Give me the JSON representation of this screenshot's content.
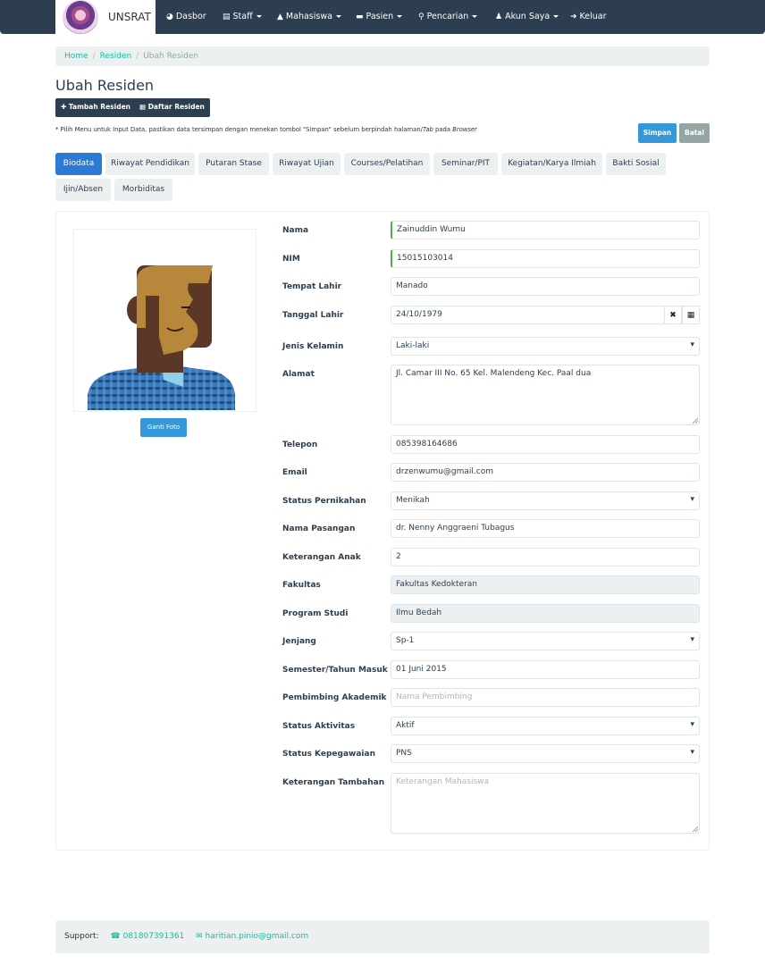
{
  "navbar": {
    "brand": "UNSRAT",
    "items": [
      {
        "label": "Dasbor",
        "icon": "dashboard-icon"
      },
      {
        "label": "Staff",
        "icon": "list-icon",
        "dropdown": true
      },
      {
        "label": "Mahasiswa",
        "icon": "graduation-cap-icon",
        "dropdown": true
      },
      {
        "label": "Pasien",
        "icon": "bed-icon",
        "dropdown": true
      },
      {
        "label": "Pencarian",
        "icon": "search-icon",
        "dropdown": true
      },
      {
        "label": "Akun Saya",
        "icon": "user-icon",
        "dropdown": true
      },
      {
        "label": "Keluar",
        "icon": "sign-out-icon"
      }
    ]
  },
  "breadcrumb": [
    "Home",
    "Residen",
    "Ubah Residen"
  ],
  "page_title": "Ubah Residen",
  "actions": {
    "add": "Tambah Residen",
    "list": "Daftar Residen"
  },
  "hint": {
    "before_tab": "* Pilih Menu untuk Input Data, pastikan data tersimpan dengan menekan tombol \"Simpan\" sebelum berpindah halaman/",
    "tab_word": "Tab",
    "middle": " pada ",
    "browser_word": "Browser"
  },
  "buttons": {
    "save": "Simpan",
    "cancel": "Batal",
    "change_photo": "Ganti Foto"
  },
  "tabs": [
    "Biodata",
    "Riwayat Pendidikan",
    "Putaran Stase",
    "Riwayat Ujian",
    "Courses/Pelatihan",
    "Seminar/PIT",
    "Kegiatan/Karya Ilmiah",
    "Bakti Sosial",
    "Ijin/Absen",
    "Morbiditas"
  ],
  "active_tab": "Biodata",
  "form": {
    "nama": {
      "label": "Nama",
      "value": "Zainuddin Wumu"
    },
    "nim": {
      "label": "NIM",
      "value": "15015103014"
    },
    "tempat_lahir": {
      "label": "Tempat Lahir",
      "value": "Manado"
    },
    "tanggal_lahir": {
      "label": "Tanggal Lahir",
      "value": "24/10/1979"
    },
    "jenis_kelamin": {
      "label": "Jenis Kelamin",
      "value": "Laki-laki"
    },
    "alamat": {
      "label": "Alamat",
      "value": "Jl. Camar III No. 65 Kel. Malendeng Kec. Paal dua"
    },
    "telepon": {
      "label": "Telepon",
      "value": "085398164686"
    },
    "email": {
      "label": "Email",
      "value": "drzenwumu@gmail.com"
    },
    "status_pernikahan": {
      "label": "Status Pernikahan",
      "value": "Menikah"
    },
    "nama_pasangan": {
      "label": "Nama Pasangan",
      "value": "dr. Nenny Anggraeni Tubagus"
    },
    "keterangan_anak": {
      "label": "Keterangan Anak",
      "value": "2"
    },
    "fakultas": {
      "label": "Fakultas",
      "value": "Fakultas Kedokteran"
    },
    "program_studi": {
      "label": "Program Studi",
      "value": "Ilmu Bedah"
    },
    "jenjang": {
      "label": "Jenjang",
      "value": "Sp-1"
    },
    "semester": {
      "label": "Semester/Tahun Masuk",
      "value": "01 Juni 2015"
    },
    "pembimbing": {
      "label": "Pembimbing Akademik",
      "placeholder": "Nama Pembimbing"
    },
    "status_aktivitas": {
      "label": "Status Aktivitas",
      "value": "Aktif"
    },
    "status_kepegawaian": {
      "label": "Status Kepegawaian",
      "value": "PNS"
    },
    "keterangan_tambahan": {
      "label": "Keterangan Tambahan",
      "placeholder": "Keterangan Mahasiswa"
    }
  },
  "footer": {
    "label": "Support:",
    "phone": "081807391361",
    "email": "haritian.pinio@gmail.com"
  }
}
